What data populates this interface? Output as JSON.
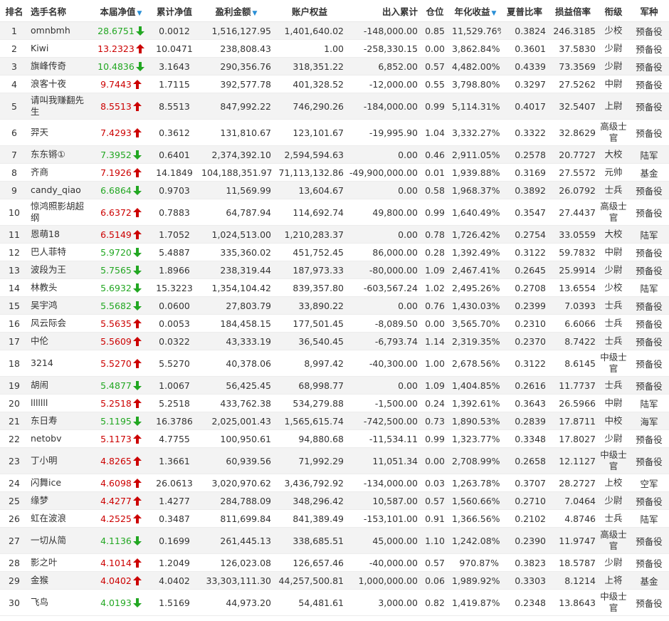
{
  "headers": [
    "排名",
    "选手名称",
    "本届净值",
    "累计净值",
    "盈利金额",
    "账户权益",
    "出入累计",
    "仓位",
    "年化收益",
    "夏普比率",
    "损益倍率",
    "衔级",
    "军种"
  ],
  "rows": [
    {
      "rank": "1",
      "name": "omnbmh",
      "nav": "28.6751",
      "trend": "down",
      "cum": "0.0012",
      "profit": "1,516,127.95",
      "equity": "1,401,640.02",
      "flow": "-148,000.00",
      "pos": "0.85",
      "annual": "11,529.76%",
      "sharpe": "0.3824",
      "pl": "246.3185",
      "title": "少校",
      "branch": "预备役"
    },
    {
      "rank": "2",
      "name": "Kiwi",
      "nav": "13.2323",
      "trend": "up",
      "cum": "10.0471",
      "profit": "238,808.43",
      "equity": "1.00",
      "flow": "-258,330.15",
      "pos": "0.00",
      "annual": "3,862.84%",
      "sharpe": "0.3601",
      "pl": "37.5830",
      "title": "少尉",
      "branch": "预备役"
    },
    {
      "rank": "3",
      "name": "旗峰传奇",
      "nav": "10.4836",
      "trend": "down",
      "cum": "3.1643",
      "profit": "290,356.76",
      "equity": "318,351.22",
      "flow": "6,852.00",
      "pos": "0.57",
      "annual": "4,482.00%",
      "sharpe": "0.4339",
      "pl": "73.3569",
      "title": "少尉",
      "branch": "预备役"
    },
    {
      "rank": "4",
      "name": "浪客十夜",
      "nav": "9.7443",
      "trend": "up",
      "cum": "1.7115",
      "profit": "392,577.78",
      "equity": "401,328.52",
      "flow": "-12,000.00",
      "pos": "0.55",
      "annual": "3,798.80%",
      "sharpe": "0.3297",
      "pl": "27.5262",
      "title": "中尉",
      "branch": "预备役"
    },
    {
      "rank": "5",
      "name": "请叫我赚翻先生",
      "nav": "8.5513",
      "trend": "up",
      "cum": "8.5513",
      "profit": "847,992.22",
      "equity": "746,290.26",
      "flow": "-184,000.00",
      "pos": "0.99",
      "annual": "5,114.31%",
      "sharpe": "0.4017",
      "pl": "32.5407",
      "title": "上尉",
      "branch": "预备役"
    },
    {
      "rank": "6",
      "name": "羿天",
      "nav": "7.4293",
      "trend": "up",
      "cum": "0.3612",
      "profit": "131,810.67",
      "equity": "123,101.67",
      "flow": "-19,995.90",
      "pos": "1.04",
      "annual": "3,332.27%",
      "sharpe": "0.3322",
      "pl": "32.8629",
      "title": "高级士官",
      "branch": "预备役"
    },
    {
      "rank": "7",
      "name": "东东锵①",
      "nav": "7.3952",
      "trend": "down",
      "cum": "0.6401",
      "profit": "2,374,392.10",
      "equity": "2,594,594.63",
      "flow": "0.00",
      "pos": "0.46",
      "annual": "2,911.05%",
      "sharpe": "0.2578",
      "pl": "20.7727",
      "title": "大校",
      "branch": "陆军"
    },
    {
      "rank": "8",
      "name": "齐商",
      "nav": "7.1926",
      "trend": "up",
      "cum": "14.1849",
      "profit": "104,188,351.97",
      "equity": "71,113,132.86",
      "flow": "-49,900,000.00",
      "pos": "0.01",
      "annual": "1,939.88%",
      "sharpe": "0.3169",
      "pl": "27.5572",
      "title": "元帅",
      "branch": "基金"
    },
    {
      "rank": "9",
      "name": "candy_qiao",
      "nav": "6.6864",
      "trend": "down",
      "cum": "0.9703",
      "profit": "11,569.99",
      "equity": "13,604.67",
      "flow": "0.00",
      "pos": "0.58",
      "annual": "1,968.37%",
      "sharpe": "0.3892",
      "pl": "26.0792",
      "title": "士兵",
      "branch": "预备役"
    },
    {
      "rank": "10",
      "name": "惊鸿照影胡超纲",
      "nav": "6.6372",
      "trend": "up",
      "cum": "0.7883",
      "profit": "64,787.94",
      "equity": "114,692.74",
      "flow": "49,800.00",
      "pos": "0.99",
      "annual": "1,640.49%",
      "sharpe": "0.3547",
      "pl": "27.4437",
      "title": "高级士官",
      "branch": "预备役"
    },
    {
      "rank": "11",
      "name": "恩萌18",
      "nav": "6.5149",
      "trend": "up",
      "cum": "1.7052",
      "profit": "1,024,513.00",
      "equity": "1,210,283.37",
      "flow": "0.00",
      "pos": "0.78",
      "annual": "1,726.42%",
      "sharpe": "0.2754",
      "pl": "33.0559",
      "title": "大校",
      "branch": "陆军"
    },
    {
      "rank": "12",
      "name": "巴人菲特",
      "nav": "5.9720",
      "trend": "down",
      "cum": "5.4887",
      "profit": "335,360.02",
      "equity": "451,752.45",
      "flow": "86,000.00",
      "pos": "0.28",
      "annual": "1,392.49%",
      "sharpe": "0.3122",
      "pl": "59.7832",
      "title": "中尉",
      "branch": "预备役"
    },
    {
      "rank": "13",
      "name": "波段为王",
      "nav": "5.7565",
      "trend": "down",
      "cum": "1.8966",
      "profit": "238,319.44",
      "equity": "187,973.33",
      "flow": "-80,000.00",
      "pos": "1.09",
      "annual": "2,467.41%",
      "sharpe": "0.2645",
      "pl": "25.9914",
      "title": "少尉",
      "branch": "预备役"
    },
    {
      "rank": "14",
      "name": "林教头",
      "nav": "5.6932",
      "trend": "down",
      "cum": "15.3223",
      "profit": "1,354,104.42",
      "equity": "839,357.80",
      "flow": "-603,567.24",
      "pos": "1.02",
      "annual": "2,495.26%",
      "sharpe": "0.2708",
      "pl": "13.6554",
      "title": "少校",
      "branch": "陆军"
    },
    {
      "rank": "15",
      "name": "吴宇鸿",
      "nav": "5.5682",
      "trend": "down",
      "cum": "0.0600",
      "profit": "27,803.79",
      "equity": "33,890.22",
      "flow": "0.00",
      "pos": "0.76",
      "annual": "1,430.03%",
      "sharpe": "0.2399",
      "pl": "7.0393",
      "title": "士兵",
      "branch": "预备役"
    },
    {
      "rank": "16",
      "name": "风云际会",
      "nav": "5.5635",
      "trend": "up",
      "cum": "0.0053",
      "profit": "184,458.15",
      "equity": "177,501.45",
      "flow": "-8,089.50",
      "pos": "0.00",
      "annual": "3,565.70%",
      "sharpe": "0.2310",
      "pl": "6.6066",
      "title": "士兵",
      "branch": "预备役"
    },
    {
      "rank": "17",
      "name": "中伦",
      "nav": "5.5609",
      "trend": "up",
      "cum": "0.0322",
      "profit": "43,333.19",
      "equity": "36,540.45",
      "flow": "-6,793.74",
      "pos": "1.14",
      "annual": "2,319.35%",
      "sharpe": "0.2370",
      "pl": "8.7422",
      "title": "士兵",
      "branch": "预备役"
    },
    {
      "rank": "18",
      "name": "3214",
      "nav": "5.5270",
      "trend": "up",
      "cum": "5.5270",
      "profit": "40,378.06",
      "equity": "8,997.42",
      "flow": "-40,300.00",
      "pos": "1.00",
      "annual": "2,678.56%",
      "sharpe": "0.3122",
      "pl": "8.6145",
      "title": "中级士官",
      "branch": "预备役"
    },
    {
      "rank": "19",
      "name": "胡闹",
      "nav": "5.4877",
      "trend": "down",
      "cum": "1.0067",
      "profit": "56,425.45",
      "equity": "68,998.77",
      "flow": "0.00",
      "pos": "1.09",
      "annual": "1,404.85%",
      "sharpe": "0.2616",
      "pl": "11.7737",
      "title": "士兵",
      "branch": "预备役"
    },
    {
      "rank": "20",
      "name": "lllllll",
      "nav": "5.2518",
      "trend": "up",
      "cum": "5.2518",
      "profit": "433,762.38",
      "equity": "534,279.88",
      "flow": "-1,500.00",
      "pos": "0.24",
      "annual": "1,392.61%",
      "sharpe": "0.3643",
      "pl": "26.5966",
      "title": "中尉",
      "branch": "陆军"
    },
    {
      "rank": "21",
      "name": "东日寿",
      "nav": "5.1195",
      "trend": "down",
      "cum": "16.3786",
      "profit": "2,025,001.43",
      "equity": "1,565,615.74",
      "flow": "-742,500.00",
      "pos": "0.73",
      "annual": "1,890.53%",
      "sharpe": "0.2839",
      "pl": "17.8711",
      "title": "中校",
      "branch": "海军"
    },
    {
      "rank": "22",
      "name": "netobv",
      "nav": "5.1173",
      "trend": "up",
      "cum": "4.7755",
      "profit": "100,950.61",
      "equity": "94,880.68",
      "flow": "-11,534.11",
      "pos": "0.99",
      "annual": "1,323.77%",
      "sharpe": "0.3348",
      "pl": "17.8027",
      "title": "少尉",
      "branch": "预备役"
    },
    {
      "rank": "23",
      "name": "丁小明",
      "nav": "4.8265",
      "trend": "up",
      "cum": "1.3661",
      "profit": "60,939.56",
      "equity": "71,992.29",
      "flow": "11,051.34",
      "pos": "0.00",
      "annual": "2,708.99%",
      "sharpe": "0.2658",
      "pl": "12.1127",
      "title": "中级士官",
      "branch": "预备役"
    },
    {
      "rank": "24",
      "name": "闪舞ice",
      "nav": "4.6098",
      "trend": "up",
      "cum": "26.0613",
      "profit": "3,020,970.62",
      "equity": "3,436,792.92",
      "flow": "-134,000.00",
      "pos": "0.03",
      "annual": "1,263.78%",
      "sharpe": "0.3707",
      "pl": "28.2727",
      "title": "上校",
      "branch": "空军"
    },
    {
      "rank": "25",
      "name": "缘梦",
      "nav": "4.4277",
      "trend": "up",
      "cum": "1.4277",
      "profit": "284,788.09",
      "equity": "348,296.42",
      "flow": "10,587.00",
      "pos": "0.57",
      "annual": "1,560.66%",
      "sharpe": "0.2710",
      "pl": "7.0464",
      "title": "少尉",
      "branch": "预备役"
    },
    {
      "rank": "26",
      "name": "虹在波浪",
      "nav": "4.2525",
      "trend": "up",
      "cum": "0.3487",
      "profit": "811,699.84",
      "equity": "841,389.49",
      "flow": "-153,101.00",
      "pos": "0.91",
      "annual": "1,366.56%",
      "sharpe": "0.2102",
      "pl": "4.8746",
      "title": "士兵",
      "branch": "陆军"
    },
    {
      "rank": "27",
      "name": "一切从简",
      "nav": "4.1136",
      "trend": "down",
      "cum": "0.1699",
      "profit": "261,445.13",
      "equity": "338,685.51",
      "flow": "45,000.00",
      "pos": "1.10",
      "annual": "1,242.08%",
      "sharpe": "0.2390",
      "pl": "11.9747",
      "title": "高级士官",
      "branch": "预备役"
    },
    {
      "rank": "28",
      "name": "影之叶",
      "nav": "4.1014",
      "trend": "up",
      "cum": "1.2049",
      "profit": "126,023.08",
      "equity": "126,657.46",
      "flow": "-40,000.00",
      "pos": "0.57",
      "annual": "970.87%",
      "sharpe": "0.3823",
      "pl": "18.5787",
      "title": "少尉",
      "branch": "预备役"
    },
    {
      "rank": "29",
      "name": "金猴",
      "nav": "4.0402",
      "trend": "up",
      "cum": "4.0402",
      "profit": "33,303,111.30",
      "equity": "44,257,500.81",
      "flow": "1,000,000.00",
      "pos": "0.06",
      "annual": "1,989.92%",
      "sharpe": "0.3303",
      "pl": "8.1214",
      "title": "上将",
      "branch": "基金"
    },
    {
      "rank": "30",
      "name": "飞鸟",
      "nav": "4.0193",
      "trend": "down",
      "cum": "1.5169",
      "profit": "44,973.20",
      "equity": "54,481.61",
      "flow": "3,000.00",
      "pos": "0.82",
      "annual": "1,419.87%",
      "sharpe": "0.2348",
      "pl": "13.8643",
      "title": "中级士官",
      "branch": "预备役"
    }
  ],
  "tall_rows": [
    5,
    6,
    10,
    18,
    23,
    27,
    30
  ],
  "colors": {
    "up": "#cc0000",
    "down": "#22a722",
    "sort": "#2a8fd6",
    "stripe": "#f3f3f3"
  }
}
